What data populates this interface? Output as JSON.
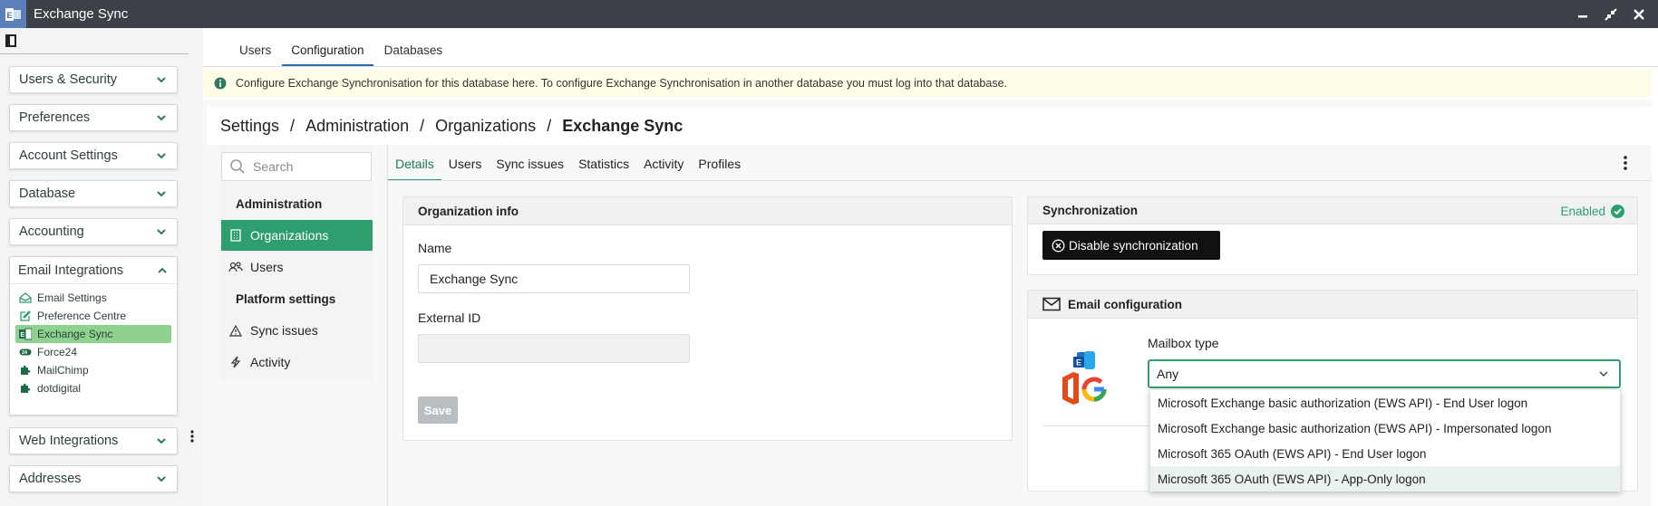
{
  "window": {
    "title": "Exchange Sync"
  },
  "sidebar": {
    "accordions": [
      {
        "label": "Users & Security"
      },
      {
        "label": "Preferences"
      },
      {
        "label": "Account Settings"
      },
      {
        "label": "Database"
      },
      {
        "label": "Accounting"
      }
    ],
    "email_integrations": {
      "label": "Email Integrations",
      "items": [
        {
          "label": "Email Settings",
          "icon": "envelope-check-icon"
        },
        {
          "label": "Preference Centre",
          "icon": "edit-icon"
        },
        {
          "label": "Exchange Sync",
          "icon": "exchange-icon",
          "selected": true
        },
        {
          "label": "Force24",
          "icon": "force24-icon"
        },
        {
          "label": "MailChimp",
          "icon": "puzzle-icon"
        },
        {
          "label": "dotdigital",
          "icon": "puzzle-icon"
        }
      ]
    },
    "lower_accordions": [
      {
        "label": "Web Integrations"
      },
      {
        "label": "Addresses"
      }
    ]
  },
  "top_tabs": [
    {
      "label": "Users"
    },
    {
      "label": "Configuration",
      "active": true
    },
    {
      "label": "Databases"
    }
  ],
  "info_banner": "Configure Exchange Synchronisation for this database here. To configure Exchange Synchronisation in another database you must log into that database.",
  "breadcrumb": [
    "Settings",
    "Administration",
    "Organizations",
    "Exchange Sync"
  ],
  "left_nav": {
    "search_placeholder": "Search",
    "sections": [
      {
        "heading": "Administration",
        "items": [
          {
            "label": "Organizations",
            "icon": "building-icon",
            "selected": true
          },
          {
            "label": "Users",
            "icon": "users-icon"
          }
        ]
      },
      {
        "heading": "Platform settings",
        "items": [
          {
            "label": "Sync issues",
            "icon": "warning-icon"
          },
          {
            "label": "Activity",
            "icon": "activity-icon"
          }
        ]
      }
    ]
  },
  "detail_tabs": [
    {
      "label": "Details",
      "active": true
    },
    {
      "label": "Users"
    },
    {
      "label": "Sync issues"
    },
    {
      "label": "Statistics"
    },
    {
      "label": "Activity"
    },
    {
      "label": "Profiles"
    }
  ],
  "org_info": {
    "title": "Organization info",
    "name_label": "Name",
    "name_value": "Exchange Sync",
    "external_id_label": "External ID",
    "external_id_value": "",
    "save_label": "Save"
  },
  "synchronization": {
    "title": "Synchronization",
    "status": "Enabled",
    "disable_label": "Disable synchronization"
  },
  "email_config": {
    "title": "Email configuration",
    "mailbox_type_label": "Mailbox type",
    "mailbox_type_value": "Any",
    "options": [
      "Microsoft Exchange basic authorization (EWS API) - End User logon",
      "Microsoft Exchange basic authorization (EWS API) - Impersonated logon",
      "Microsoft 365 OAuth (EWS API) - End User logon",
      "Microsoft 365 OAuth (EWS API) - App-Only logon"
    ]
  },
  "colors": {
    "accent": "#2f9e6e",
    "titlebar": "#3c4147",
    "info_bg": "#fffde7",
    "selected_sub": "#8fd18e"
  }
}
